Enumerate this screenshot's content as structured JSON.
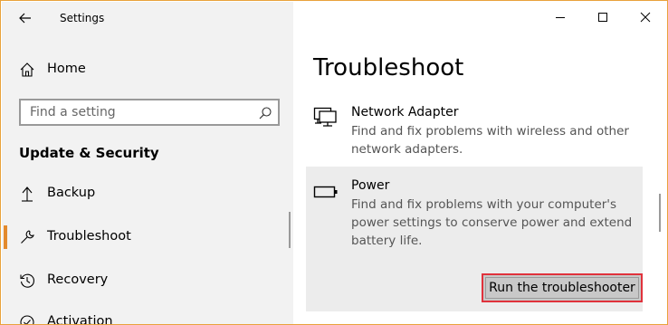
{
  "window": {
    "title": "Settings",
    "accent_color": "#e38a2d",
    "border_color": "#e9a23b"
  },
  "sidebar": {
    "home_label": "Home",
    "search_placeholder": "Find a setting",
    "section_title": "Update & Security",
    "items": [
      {
        "label": "Backup",
        "icon": "backup-arrow-icon",
        "selected": false
      },
      {
        "label": "Troubleshoot",
        "icon": "wrench-icon",
        "selected": true
      },
      {
        "label": "Recovery",
        "icon": "recovery-history-icon",
        "selected": false
      },
      {
        "label": "Activation",
        "icon": "activation-icon",
        "selected": false
      }
    ]
  },
  "main": {
    "title": "Troubleshoot",
    "items": [
      {
        "title": "Network Adapter",
        "description": "Find and fix problems with wireless and other network adapters.",
        "icon": "network-adapter-icon"
      },
      {
        "title": "Power",
        "description": "Find and fix problems with your computer's power settings to conserve power and extend battery life.",
        "icon": "battery-icon",
        "button_label": "Run the troubleshooter"
      }
    ]
  },
  "highlight_color": "#e0323c"
}
